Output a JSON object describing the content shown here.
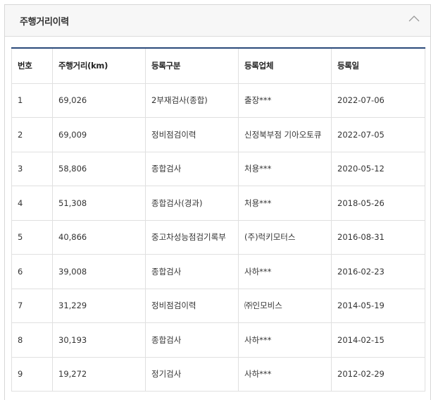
{
  "panel": {
    "title": "주행거리이력",
    "collapse_icon": "chevron-up-icon"
  },
  "table": {
    "headers": [
      "번호",
      "주행거리(km)",
      "등록구분",
      "등록업체",
      "등록일"
    ],
    "rows": [
      [
        "1",
        "69,026",
        "2부재검사(종합)",
        "출장***",
        "2022-07-06"
      ],
      [
        "2",
        "69,009",
        "정비점검이력",
        "신정북부점 기아오토큐",
        "2022-07-05"
      ],
      [
        "3",
        "58,806",
        "종합검사",
        "처용***",
        "2020-05-12"
      ],
      [
        "4",
        "51,308",
        "종합검사(경과)",
        "처용***",
        "2018-05-26"
      ],
      [
        "5",
        "40,866",
        "중고차성능점검기록부",
        "(주)럭키모터스",
        "2016-08-31"
      ],
      [
        "6",
        "39,008",
        "종합검사",
        "사하***",
        "2016-02-23"
      ],
      [
        "7",
        "31,229",
        "정비점검이력",
        "㈜인모비스",
        "2014-05-19"
      ],
      [
        "8",
        "30,193",
        "종합검사",
        "사하***",
        "2014-02-15"
      ],
      [
        "9",
        "19,272",
        "정기검사",
        "사하***",
        "2012-02-29"
      ]
    ]
  },
  "colors": {
    "header_bg": "#f7f7f7",
    "table_top_border": "#2b4a7a",
    "cell_border": "#e0e0e0"
  }
}
